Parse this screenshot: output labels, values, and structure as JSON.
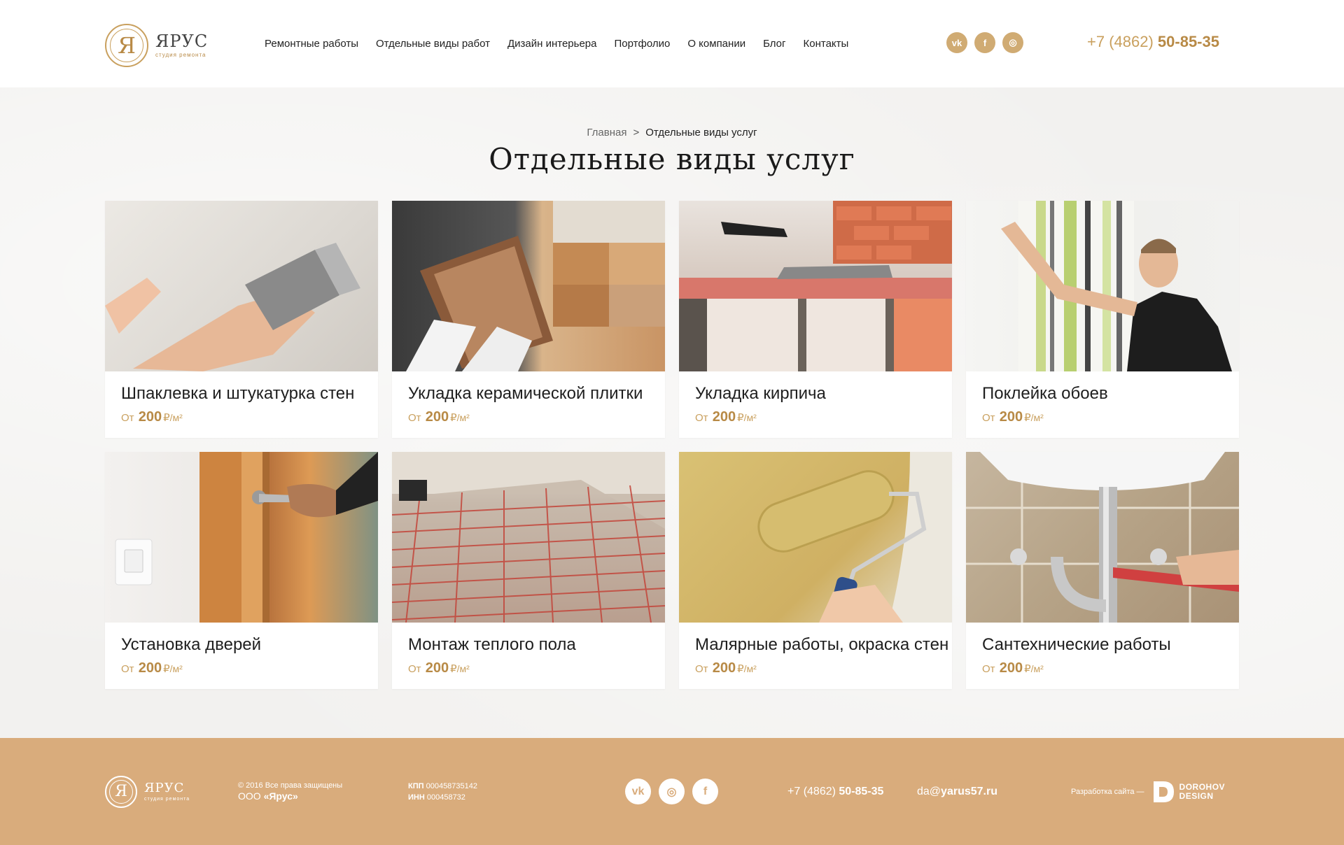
{
  "header": {
    "logo": {
      "glyph": "Я",
      "name": "ЯРУС",
      "subtitle": "студия ремонта"
    },
    "nav": [
      {
        "label": "Ремонтные работы"
      },
      {
        "label": "Отдельные виды работ"
      },
      {
        "label": "Дизайн интерьера"
      },
      {
        "label": "Портфолио"
      },
      {
        "label": "О компании"
      },
      {
        "label": "Блог"
      },
      {
        "label": "Контакты"
      }
    ],
    "social": [
      {
        "icon": "vk-icon",
        "glyph": "vk"
      },
      {
        "icon": "facebook-icon",
        "glyph": "f"
      },
      {
        "icon": "instagram-icon",
        "glyph": "◎"
      }
    ],
    "phone_prefix": "+7 (4862) ",
    "phone_main": "50-85-35"
  },
  "main": {
    "breadcrumb": {
      "home": "Главная",
      "separator": ">",
      "current": "Отдельные виды услуг"
    },
    "title": "Отдельные виды услуг",
    "price_prefix": "От",
    "price_currency": "₽",
    "price_unit": "/м²",
    "cards": [
      {
        "title": "Шпаклевка и штукатурка стен",
        "price": "200"
      },
      {
        "title": "Укладка керамической плитки",
        "price": "200"
      },
      {
        "title": "Укладка кирпича",
        "price": "200"
      },
      {
        "title": "Поклейка обоев",
        "price": "200"
      },
      {
        "title": "Установка дверей",
        "price": "200"
      },
      {
        "title": "Монтаж теплого пола",
        "price": "200"
      },
      {
        "title": "Малярные работы, окраска стен",
        "price": "200"
      },
      {
        "title": "Сантехнические работы",
        "price": "200"
      }
    ]
  },
  "footer": {
    "logo": {
      "glyph": "Я",
      "name": "ЯРУС",
      "subtitle": "студия ремонта"
    },
    "copyright": "© 2016 Все права защищены",
    "org_prefix": "ООО ",
    "org_name": "«Ярус»",
    "kpp_label": "КПП",
    "kpp_value": "000458735142",
    "inn_label": "ИНН",
    "inn_value": "000458732",
    "social": [
      {
        "icon": "vk-icon",
        "glyph": "vk"
      },
      {
        "icon": "instagram-icon",
        "glyph": "◎"
      },
      {
        "icon": "facebook-icon",
        "glyph": "f"
      }
    ],
    "phone_prefix": "+7 (4862) ",
    "phone_main": "50-85-35",
    "email_user": "da@",
    "email_domain": "yarus57.ru",
    "dev_label": "Разработка сайта —",
    "dev_name_1": "DOROHOV",
    "dev_name_2": "DESIGN"
  },
  "colors": {
    "accent": "#c9a05e",
    "accent_dark": "#b88a46",
    "footer_bg": "#d9ac7c",
    "page_bg": "#f2f1ef"
  }
}
